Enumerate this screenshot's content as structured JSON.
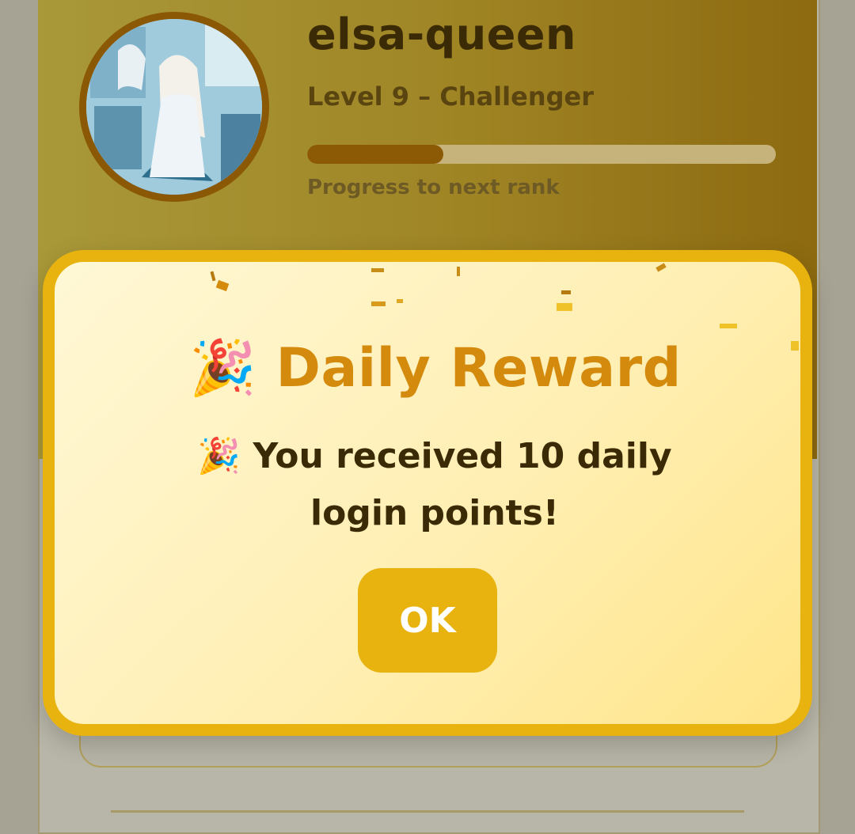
{
  "profile": {
    "username": "elsa-queen",
    "level": "Level 9 – Challenger",
    "progress": 0.29,
    "progress_label": "Progress to next rank",
    "avatar_icon": "elsa-avatar-image"
  },
  "modal": {
    "title_icon": "🎉",
    "title": "Daily Reward",
    "message": "🎉 You received 10 daily login points!",
    "ok_label": "OK"
  },
  "colors": {
    "accent": "#e8b30f",
    "title": "#d48a0c",
    "text_dark": "#3b2a06",
    "progress_fill": "#8c5a05"
  }
}
